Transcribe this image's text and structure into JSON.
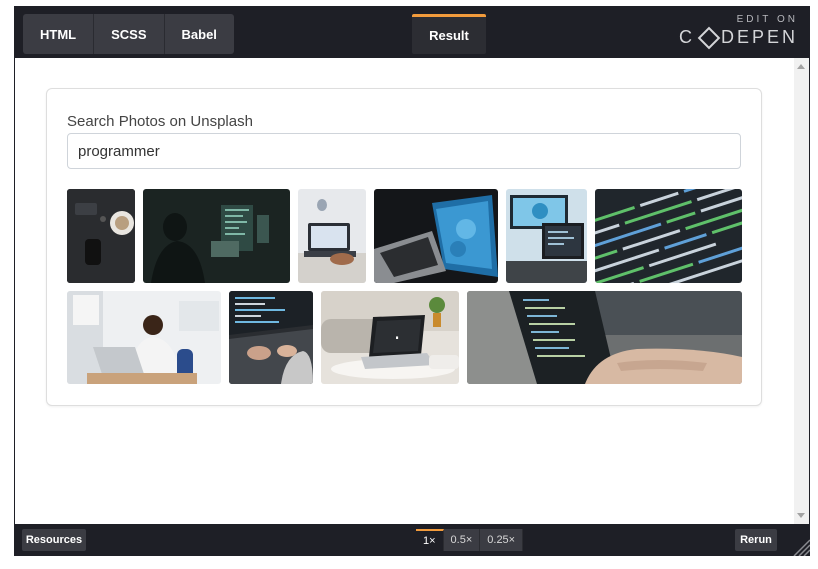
{
  "editor": {
    "tabs": [
      {
        "label": "HTML"
      },
      {
        "label": "SCSS"
      },
      {
        "label": "Babel"
      }
    ],
    "result_tab": "Result",
    "brand_small": "EDIT ON",
    "brand_name_a": "C",
    "brand_name_b": "DEPEN"
  },
  "app": {
    "search_label": "Search Photos on Unsplash",
    "search_value": "programmer"
  },
  "footer": {
    "resources_label": "Resources",
    "zoom_options": [
      "1×",
      "0.5×",
      "0.25×"
    ],
    "active_zoom": "1×",
    "rerun_label": "Rerun"
  },
  "colors": {
    "chrome": "#1e1f26",
    "tab": "#3b3c43",
    "accent": "#f29b3c"
  },
  "photos": [
    {
      "name": "photo-coffee-desk",
      "icon": "coffee-cup-image"
    },
    {
      "name": "photo-dark-room-programmer",
      "icon": "monitor-image"
    },
    {
      "name": "photo-laptop-hands",
      "icon": "laptop-image"
    },
    {
      "name": "photo-laptop-blue-screen",
      "icon": "laptop-image"
    },
    {
      "name": "photo-monitor-desk",
      "icon": "monitor-image"
    },
    {
      "name": "photo-code-screen",
      "icon": "code-image"
    },
    {
      "name": "photo-man-laptop",
      "icon": "person-image"
    },
    {
      "name": "photo-typing-keyboard",
      "icon": "keyboard-image"
    },
    {
      "name": "photo-laptop-clock",
      "icon": "laptop-image"
    },
    {
      "name": "photo-hands-laptop-code",
      "icon": "laptop-image"
    }
  ]
}
